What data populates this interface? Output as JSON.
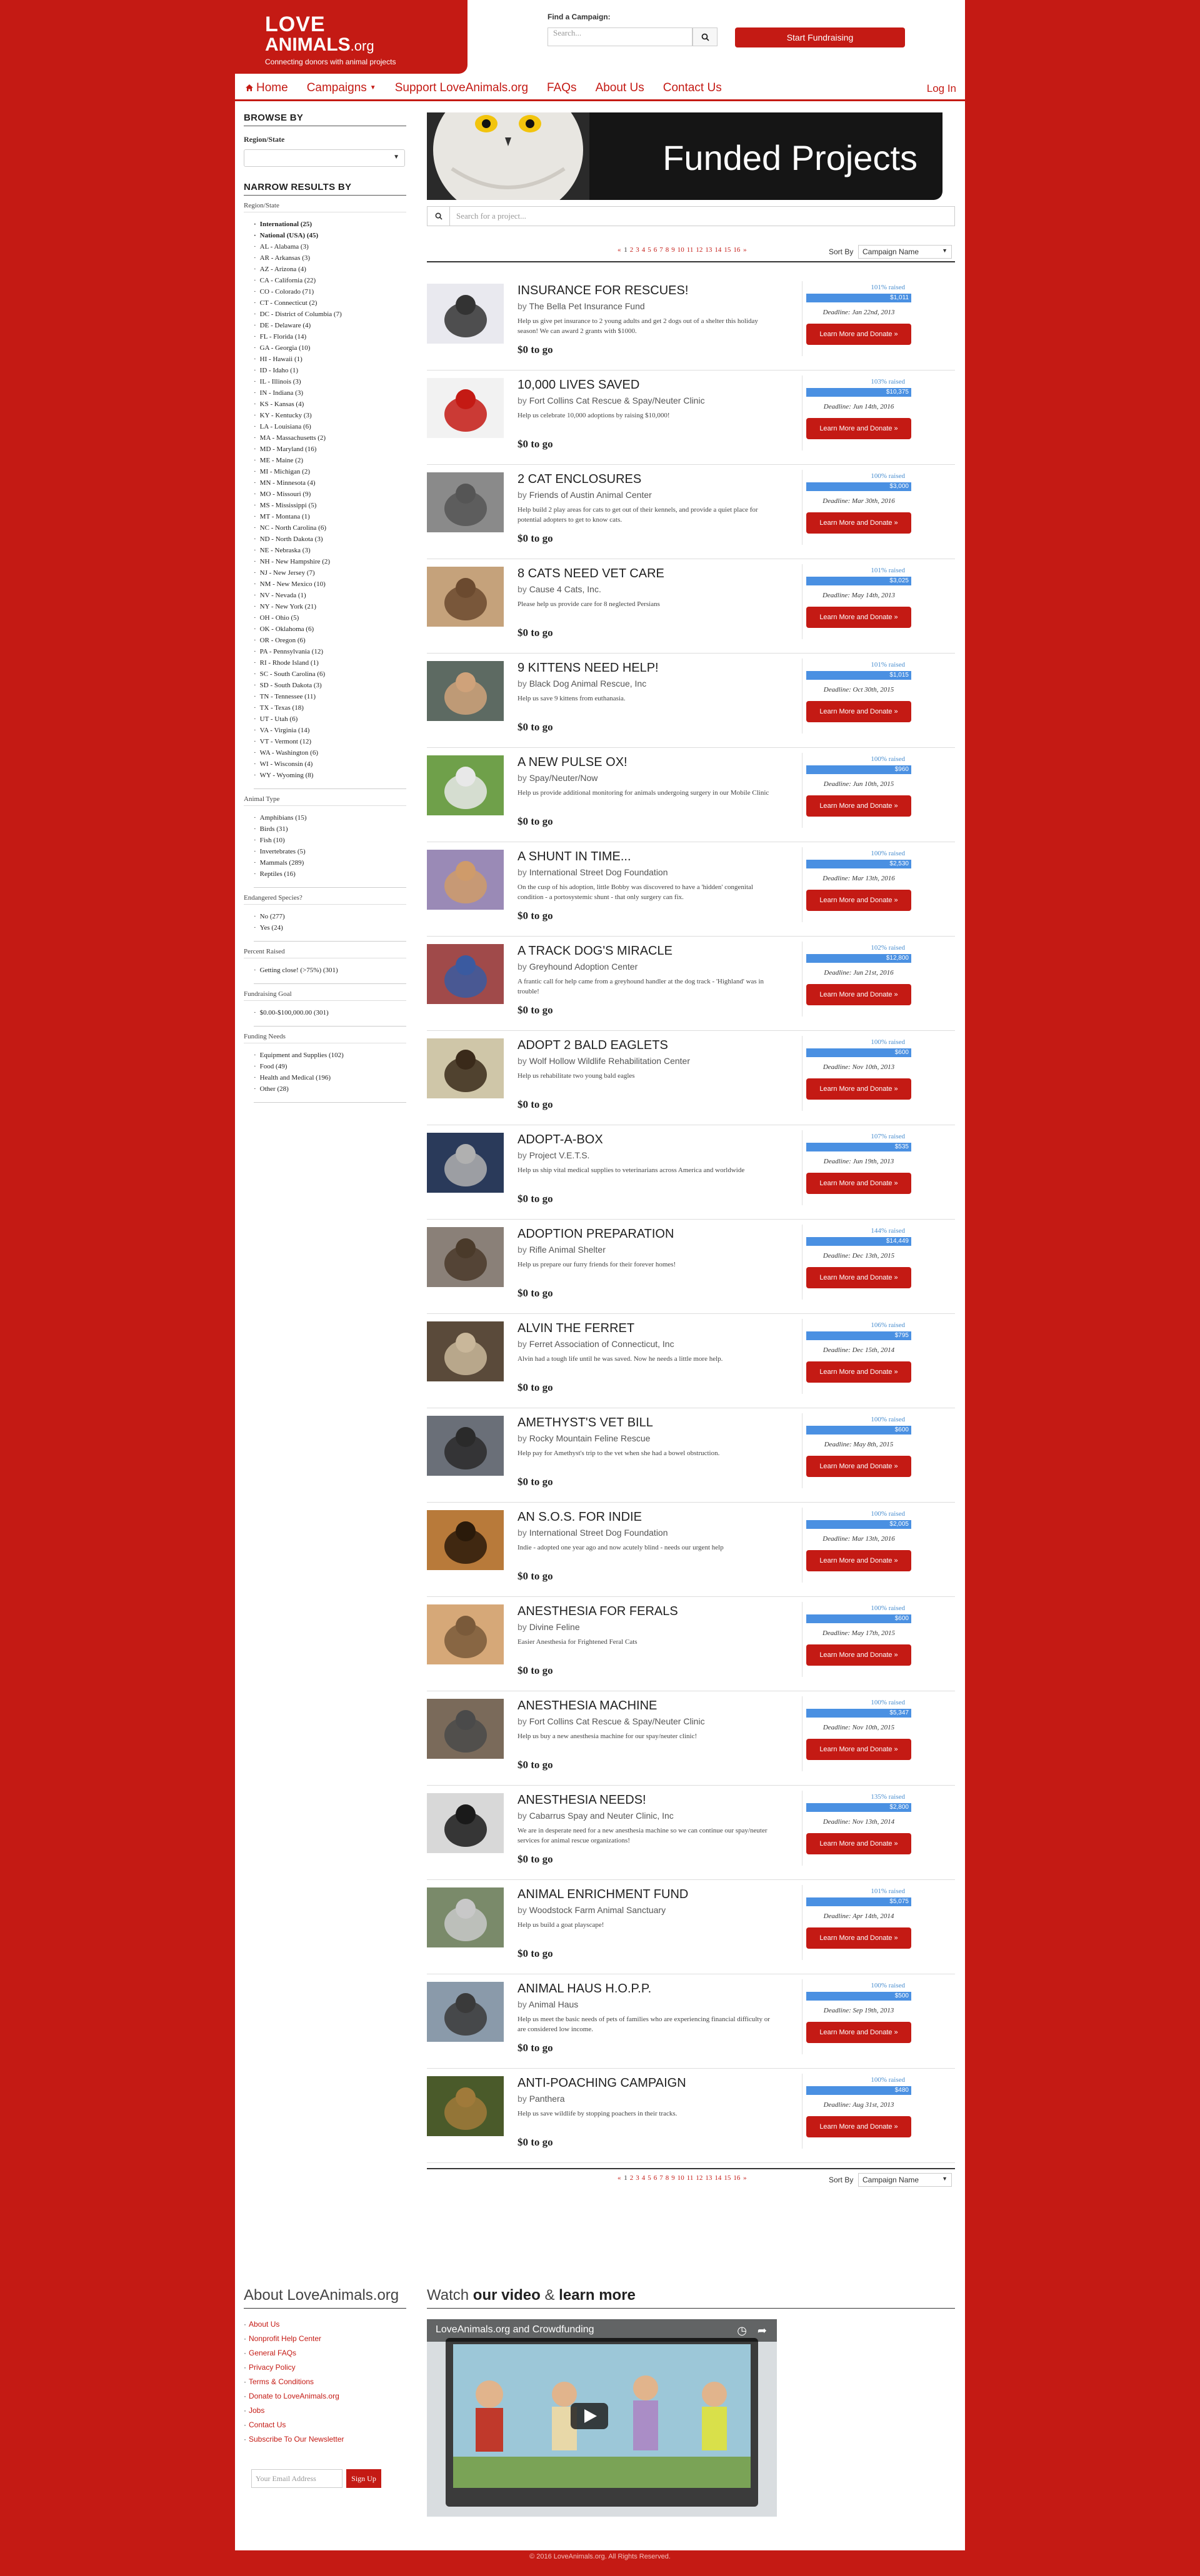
{
  "header": {
    "logo_line1": "LOVE",
    "logo_line2": "ANIMALS",
    "logo_suffix": ".org",
    "tagline": "Connecting donors with animal projects",
    "find_label": "Find a Campaign:",
    "search_placeholder": "Search...",
    "fundraise_label": "Start Fundraising"
  },
  "nav": {
    "home": "Home",
    "campaigns": "Campaigns",
    "support": "Support LoveAnimals.org",
    "faqs": "FAQs",
    "about": "About Us",
    "contact": "Contact Us",
    "login": "Log In"
  },
  "sidebar": {
    "browse_by": "BROWSE BY",
    "region_state": "Region/State",
    "narrow": "NARROW RESULTS BY",
    "group_region": "Region/State",
    "regions": [
      "International (25)",
      "National (USA) (45)",
      "AL - Alabama (3)",
      "AR - Arkansas (3)",
      "AZ - Arizona (4)",
      "CA - California (22)",
      "CO - Colorado (71)",
      "CT - Connecticut (2)",
      "DC - District of Columbia (7)",
      "DE - Delaware (4)",
      "FL - Florida (14)",
      "GA - Georgia (10)",
      "HI - Hawaii (1)",
      "ID - Idaho (1)",
      "IL - Illinois (3)",
      "IN - Indiana (3)",
      "KS - Kansas (4)",
      "KY - Kentucky (3)",
      "LA - Louisiana (6)",
      "MA - Massachusetts (2)",
      "MD - Maryland (16)",
      "ME - Maine (2)",
      "MI - Michigan (2)",
      "MN - Minnesota (4)",
      "MO - Missouri (9)",
      "MS - Mississippi (5)",
      "MT - Montana (1)",
      "NC - North Carolina (6)",
      "ND - North Dakota (3)",
      "NE - Nebraska (3)",
      "NH - New Hampshire (2)",
      "NJ - New Jersey (7)",
      "NM - New Mexico (10)",
      "NV - Nevada (1)",
      "NY - New York (21)",
      "OH - Ohio (5)",
      "OK - Oklahoma (6)",
      "OR - Oregon (6)",
      "PA - Pennsylvania (12)",
      "RI - Rhode Island (1)",
      "SC - South Carolina (6)",
      "SD - South Dakota (3)",
      "TN - Tennessee (11)",
      "TX - Texas (18)",
      "UT - Utah (6)",
      "VA - Virginia (14)",
      "VT - Vermont (12)",
      "WA - Washington (6)",
      "WI - Wisconsin (4)",
      "WY - Wyoming (8)"
    ],
    "group_animal": "Animal Type",
    "animals": [
      "Amphibians (15)",
      "Birds (31)",
      "Fish (10)",
      "Invertebrates (5)",
      "Mammals (289)",
      "Reptiles (16)"
    ],
    "group_endangered": "Endangered Species?",
    "endangered": [
      "No (277)",
      "Yes (24)"
    ],
    "group_percent": "Percent Raised",
    "percent": [
      "Getting close! (>75%) (301)"
    ],
    "group_goal": "Fundraising Goal",
    "goal": [
      "$0.00-$100,000.00 (301)"
    ],
    "group_needs": "Funding Needs",
    "needs": [
      "Equipment and Supplies (102)",
      "Food (49)",
      "Health and Medical (196)",
      "Other (28)"
    ]
  },
  "main": {
    "banner_title": "Funded Projects",
    "project_search_placeholder": "Search for a project...",
    "pager_prev": "«",
    "pager_pages": [
      "1",
      "2",
      "3",
      "4",
      "5",
      "6",
      "7",
      "8",
      "9",
      "10",
      "11",
      "12",
      "13",
      "14",
      "15",
      "16"
    ],
    "pager_next": "»",
    "sort_label": "Sort By",
    "sort_value": "Campaign Name",
    "by_label": "by",
    "donate_label": "Learn More and Donate »"
  },
  "projects": [
    {
      "title": "INSURANCE FOR RESCUES!",
      "org": "The Bella Pet Insurance Fund",
      "desc": "Help us give pet insurance to 2 young adults and get 2 dogs out of a shelter this holiday season! We can award 2 grants with $1000.",
      "raised": "$0 to go",
      "pct_label": "101% raised",
      "pct": 100,
      "amount": "$1,011",
      "deadline": "Deadline: Jan 22nd, 2013"
    },
    {
      "title": "10,000 LIVES SAVED",
      "org": "Fort Collins Cat Rescue & Spay/Neuter Clinic",
      "desc": "Help us celebrate 10,000 adoptions by raising $10,000!",
      "raised": "$0 to go",
      "pct_label": "103% raised",
      "pct": 100,
      "amount": "$10,375",
      "deadline": "Deadline: Jun 14th, 2016"
    },
    {
      "title": "2 CAT ENCLOSURES",
      "org": "Friends of Austin Animal Center",
      "desc": "Help build 2 play areas for cats to get out of their kennels, and provide a quiet place for potential adopters to get to know cats.",
      "raised": "$0 to go",
      "pct_label": "100% raised",
      "pct": 100,
      "amount": "$3,000",
      "deadline": "Deadline: Mar 30th, 2016"
    },
    {
      "title": "8 CATS NEED VET CARE",
      "org": "Cause 4 Cats, Inc.",
      "desc": "Please help us provide care for 8 neglected Persians",
      "raised": "$0 to go",
      "pct_label": "101% raised",
      "pct": 100,
      "amount": "$3,025",
      "deadline": "Deadline: May 14th, 2013"
    },
    {
      "title": "9 KITTENS NEED HELP!",
      "org": "Black Dog Animal Rescue, Inc",
      "desc": "Help us save 9 kittens from euthanasia.",
      "raised": "$0 to go",
      "pct_label": "101% raised",
      "pct": 100,
      "amount": "$1,015",
      "deadline": "Deadline: Oct 30th, 2015"
    },
    {
      "title": "A NEW PULSE OX!",
      "org": "Spay/Neuter/Now",
      "desc": "Help us provide additional monitoring for animals undergoing surgery in our Mobile Clinic",
      "raised": "$0 to go",
      "pct_label": "100% raised",
      "pct": 100,
      "amount": "$960",
      "deadline": "Deadline: Jun 10th, 2015"
    },
    {
      "title": "A SHUNT IN TIME...",
      "org": "International Street Dog Foundation",
      "desc": "On the cusp of his adoption, little Bobby was discovered to have a 'hidden' congenital condition - a portosystemic shunt - that only surgery can fix.",
      "raised": "$0 to go",
      "pct_label": "100% raised",
      "pct": 100,
      "amount": "$2,530",
      "deadline": "Deadline: Mar 13th, 2016"
    },
    {
      "title": "A TRACK DOG'S MIRACLE",
      "org": "Greyhound Adoption Center",
      "desc": "A frantic call for help came from a greyhound handler at the dog track - 'Highland' was in trouble!",
      "raised": "$0 to go",
      "pct_label": "102% raised",
      "pct": 100,
      "amount": "$12,800",
      "deadline": "Deadline: Jun 21st, 2016"
    },
    {
      "title": "ADOPT 2 BALD EAGLETS",
      "org": "Wolf Hollow Wildlife Rehabilitation Center",
      "desc": "Help us rehabilitate two young bald eagles",
      "raised": "$0 to go",
      "pct_label": "100% raised",
      "pct": 100,
      "amount": "$600",
      "deadline": "Deadline: Nov 10th, 2013"
    },
    {
      "title": "ADOPT-A-BOX",
      "org": "Project V.E.T.S.",
      "desc": "Help us ship vital medical supplies to veterinarians across America and worldwide",
      "raised": "$0 to go",
      "pct_label": "107% raised",
      "pct": 100,
      "amount": "$535",
      "deadline": "Deadline: Jun 19th, 2013"
    },
    {
      "title": "ADOPTION PREPARATION",
      "org": "Rifle Animal Shelter",
      "desc": "Help us prepare our furry friends for their forever homes!",
      "raised": "$0 to go",
      "pct_label": "144% raised",
      "pct": 100,
      "amount": "$14,449",
      "deadline": "Deadline: Dec 13th, 2015"
    },
    {
      "title": "ALVIN THE FERRET",
      "org": "Ferret Association of Connecticut, Inc",
      "desc": "Alvin had a tough life until he was saved. Now he needs a little more help.",
      "raised": "$0 to go",
      "pct_label": "106% raised",
      "pct": 100,
      "amount": "$795",
      "deadline": "Deadline: Dec 15th, 2014"
    },
    {
      "title": "AMETHYST'S VET BILL",
      "org": "Rocky Mountain Feline Rescue",
      "desc": "Help pay for Amethyst's trip to the vet when she had a bowel obstruction.",
      "raised": "$0 to go",
      "pct_label": "100% raised",
      "pct": 100,
      "amount": "$600",
      "deadline": "Deadline: May 8th, 2015"
    },
    {
      "title": "AN S.O.S. FOR INDIE",
      "org": "International Street Dog Foundation",
      "desc": "Indie - adopted one year ago and now acutely blind - needs our urgent help",
      "raised": "$0 to go",
      "pct_label": "100% raised",
      "pct": 100,
      "amount": "$2,005",
      "deadline": "Deadline: Mar 13th, 2016"
    },
    {
      "title": "ANESTHESIA FOR FERALS",
      "org": "Divine Feline",
      "desc": "Easier Anesthesia for Frightened Feral Cats",
      "raised": "$0 to go",
      "pct_label": "100% raised",
      "pct": 100,
      "amount": "$600",
      "deadline": "Deadline: May 17th, 2015"
    },
    {
      "title": "ANESTHESIA MACHINE",
      "org": "Fort Collins Cat Rescue & Spay/Neuter Clinic",
      "desc": "Help us buy a new anesthesia machine for our spay/neuter clinic!",
      "raised": "$0 to go",
      "pct_label": "100% raised",
      "pct": 100,
      "amount": "$5,347",
      "deadline": "Deadline: Nov 10th, 2015"
    },
    {
      "title": "ANESTHESIA NEEDS!",
      "org": "Cabarrus Spay and Neuter Clinic, Inc",
      "desc": "We are in desperate need for a new anesthesia machine so we can continue our spay/neuter services for animal rescue organizations!",
      "raised": "$0 to go",
      "pct_label": "135% raised",
      "pct": 100,
      "amount": "$2,800",
      "deadline": "Deadline: Nov 13th, 2014"
    },
    {
      "title": "ANIMAL ENRICHMENT FUND",
      "org": "Woodstock Farm Animal Sanctuary",
      "desc": "Help us build a goat playscape!",
      "raised": "$0 to go",
      "pct_label": "101% raised",
      "pct": 100,
      "amount": "$5,075",
      "deadline": "Deadline: Apr 14th, 2014"
    },
    {
      "title": "ANIMAL HAUS H.O.P.P.",
      "org": "Animal Haus",
      "desc": "Help us meet the basic needs of pets of families who are experiencing financial difficulty or are considered low income.",
      "raised": "$0 to go",
      "pct_label": "100% raised",
      "pct": 100,
      "amount": "$500",
      "deadline": "Deadline: Sep 19th, 2013"
    },
    {
      "title": "ANTI-POACHING CAMPAIGN",
      "org": "Panthera",
      "desc": "Help us save wildlife by stopping poachers in their tracks.",
      "raised": "$0 to go",
      "pct_label": "100% raised",
      "pct": 100,
      "amount": "$480",
      "deadline": "Deadline: Aug 31st, 2013"
    }
  ],
  "footer": {
    "about_title": "About LoveAnimals.org",
    "links": [
      "About Us",
      "Nonprofit Help Center",
      "General FAQs",
      "Privacy Policy",
      "Terms & Conditions",
      "Donate to LoveAnimals.org",
      "Jobs",
      "Contact Us",
      "Subscribe To Our Newsletter"
    ],
    "email_placeholder": "Your Email Address",
    "signup_label": "Sign Up",
    "watch_prefix": "Watch",
    "watch_bold1": "our video",
    "watch_and": "&",
    "watch_bold2": "learn more",
    "video_title": "LoveAnimals.org and Crowdfunding",
    "copyright": "© 2016 LoveAnimals.org. All Rights Reserved."
  },
  "colors": {
    "brand_red": "#c41a14",
    "progress_blue": "#4a90e2",
    "link_blue": "#4a8ecf"
  }
}
